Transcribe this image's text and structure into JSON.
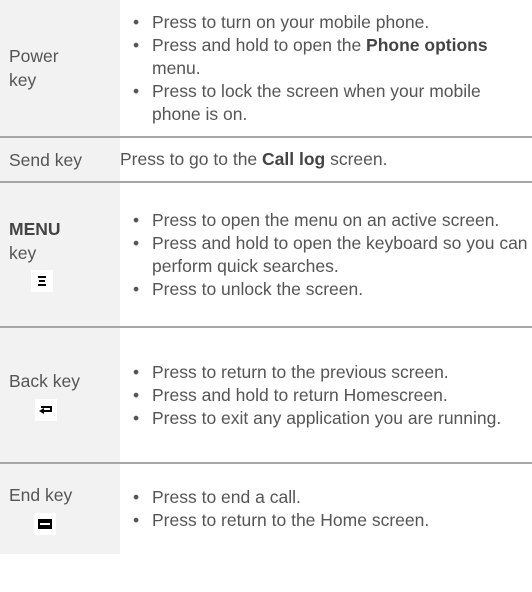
{
  "rows": [
    {
      "key": "Power key",
      "bullets": [
        "Press to turn on your mobile phone.",
        [
          "Press and hold to open the ",
          "Phone options",
          " menu."
        ],
        "Press to lock the screen when your mobile phone is on."
      ]
    },
    {
      "key": "Send key",
      "text": [
        "Press to go to the ",
        "Call log",
        " screen."
      ]
    },
    {
      "key_bold": "MENU",
      "key_rest": "key",
      "icon": "menu-key-icon",
      "bullets": [
        "Press to open the menu on an active screen.",
        "Press and hold to open the keyboard so you can perform quick searches.",
        "Press to unlock the screen."
      ]
    },
    {
      "key": "Back key",
      "icon": "back-key-icon",
      "bullets": [
        "Press to return to the previous screen.",
        "Press and hold to return Homescreen.",
        "Press to exit any application you are running."
      ]
    },
    {
      "key": "End key",
      "icon": "end-key-icon",
      "bullets": [
        "Press to end a call.",
        "Press to return to the Home screen."
      ]
    }
  ]
}
